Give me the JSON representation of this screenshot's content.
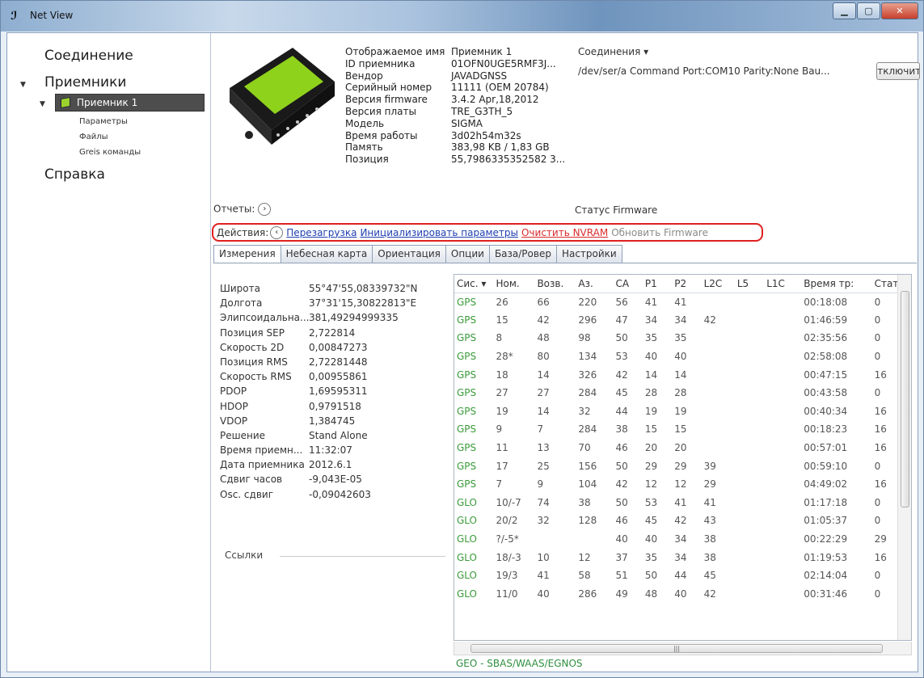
{
  "window": {
    "title": "Net View"
  },
  "sidebar": {
    "connection": "Соединение",
    "receivers": "Приемники",
    "receiver1": "Приемник 1",
    "sub": [
      "Параметры",
      "Файлы",
      "Greis команды"
    ],
    "help": "Справка"
  },
  "info": {
    "rows": [
      {
        "k": "Отображаемое имя",
        "v": "Приемник 1"
      },
      {
        "k": "ID приемника",
        "v": "01OFN0UGE5RMF3J..."
      },
      {
        "k": "Вендор",
        "v": "JAVADGNSS"
      },
      {
        "k": "Серийный номер",
        "v": "11111 (OEM 20784)"
      },
      {
        "k": "Версия firmware",
        "v": "3.4.2 Apr,18,2012"
      },
      {
        "k": "Версия платы",
        "v": "TRE_G3TH_5"
      },
      {
        "k": "Модель",
        "v": "SIGMA"
      },
      {
        "k": "Время работы",
        "v": "3d02h54m32s"
      },
      {
        "k": "Память",
        "v": "383,98 KB / 1,83 GB"
      },
      {
        "k": "Позиция",
        "v": "55,7986335352582 3..."
      }
    ]
  },
  "connections": {
    "label": "Соединения ▾",
    "text": "/dev/ser/a Command Port:COM10 Parity:None Bau...",
    "disconnect": "Отключить"
  },
  "reports_label": "Отчеты:",
  "fw_status": "Статус Firmware",
  "actions": {
    "label": "Действия:",
    "reboot": "Перезагрузка",
    "init": "Инициализировать параметры",
    "nvram": "Очистить NVRAM",
    "update": "Обновить Firmware"
  },
  "tabs": [
    "Измерения",
    "Небесная карта",
    "Ориентация",
    "Опции",
    "База/Ровер",
    "Настройки"
  ],
  "measurements": [
    {
      "k": "Широта",
      "v": "55°47'55,08339732\"N"
    },
    {
      "k": "Долгота",
      "v": "37°31'15,30822813\"E"
    },
    {
      "k": "Элипсоидальна...",
      "v": "381,49294999335"
    },
    {
      "k": "Позиция SEP",
      "v": "2,722814"
    },
    {
      "k": "Скорость 2D",
      "v": "0,00847273"
    },
    {
      "k": "Позиция RMS",
      "v": "2,72281448"
    },
    {
      "k": "Скорость RMS",
      "v": "0,00955861"
    },
    {
      "k": "PDOP",
      "v": "1,69595311"
    },
    {
      "k": "HDOP",
      "v": "0,9791518"
    },
    {
      "k": "VDOP",
      "v": "1,384745"
    },
    {
      "k": "Решение",
      "v": "Stand Alone"
    },
    {
      "k": "Время приемн...",
      "v": "11:32:07"
    },
    {
      "k": "Дата приемника",
      "v": "2012.6.1"
    },
    {
      "k": "Сдвиг часов",
      "v": "-9,043E-05"
    },
    {
      "k": "Osc. сдвиг",
      "v": "-0,09042603"
    }
  ],
  "links_label": "Ссылки",
  "sat_columns": [
    "Сис. ▾",
    "Ном.",
    "Возв.",
    "Аз.",
    "CA",
    "P1",
    "P2",
    "L2C",
    "L5",
    "L1C",
    "Время тр:",
    "Стату"
  ],
  "sat_rows": [
    [
      "GPS",
      "26",
      "66",
      "220",
      "56",
      "41",
      "41",
      "",
      "",
      "",
      "00:18:08",
      "0"
    ],
    [
      "GPS",
      "15",
      "42",
      "296",
      "47",
      "34",
      "34",
      "42",
      "",
      "",
      "01:46:59",
      "0"
    ],
    [
      "GPS",
      "8",
      "48",
      "98",
      "50",
      "35",
      "35",
      "",
      "",
      "",
      "02:35:56",
      "0"
    ],
    [
      "GPS",
      "28*",
      "80",
      "134",
      "53",
      "40",
      "40",
      "",
      "",
      "",
      "02:58:08",
      "0"
    ],
    [
      "GPS",
      "18",
      "14",
      "326",
      "42",
      "14",
      "14",
      "",
      "",
      "",
      "00:47:15",
      "16"
    ],
    [
      "GPS",
      "27",
      "27",
      "284",
      "45",
      "28",
      "28",
      "",
      "",
      "",
      "00:43:58",
      "0"
    ],
    [
      "GPS",
      "19",
      "14",
      "32",
      "44",
      "19",
      "19",
      "",
      "",
      "",
      "00:40:34",
      "16"
    ],
    [
      "GPS",
      "9",
      "7",
      "284",
      "38",
      "15",
      "15",
      "",
      "",
      "",
      "00:18:23",
      "16"
    ],
    [
      "GPS",
      "11",
      "13",
      "70",
      "46",
      "20",
      "20",
      "",
      "",
      "",
      "00:57:01",
      "16"
    ],
    [
      "GPS",
      "17",
      "25",
      "156",
      "50",
      "29",
      "29",
      "39",
      "",
      "",
      "00:59:10",
      "0"
    ],
    [
      "GPS",
      "7",
      "9",
      "104",
      "42",
      "12",
      "12",
      "29",
      "",
      "",
      "04:49:02",
      "16"
    ],
    [
      "GLO",
      "10/-7",
      "74",
      "38",
      "50",
      "53",
      "41",
      "41",
      "",
      "",
      "01:17:18",
      "0"
    ],
    [
      "GLO",
      "20/2",
      "32",
      "128",
      "46",
      "45",
      "42",
      "43",
      "",
      "",
      "01:05:37",
      "0"
    ],
    [
      "GLO",
      "?/-5*",
      "",
      "",
      "40",
      "40",
      "34",
      "38",
      "",
      "",
      "00:22:29",
      "29"
    ],
    [
      "GLO",
      "18/-3",
      "10",
      "12",
      "37",
      "35",
      "34",
      "38",
      "",
      "",
      "01:19:53",
      "16"
    ],
    [
      "GLO",
      "19/3",
      "41",
      "58",
      "51",
      "50",
      "44",
      "45",
      "",
      "",
      "02:14:04",
      "0"
    ],
    [
      "GLO",
      "11/0",
      "40",
      "286",
      "49",
      "48",
      "40",
      "42",
      "",
      "",
      "00:31:46",
      "0"
    ]
  ],
  "geo_label": "GEO - SBAS/WAAS/EGNOS"
}
